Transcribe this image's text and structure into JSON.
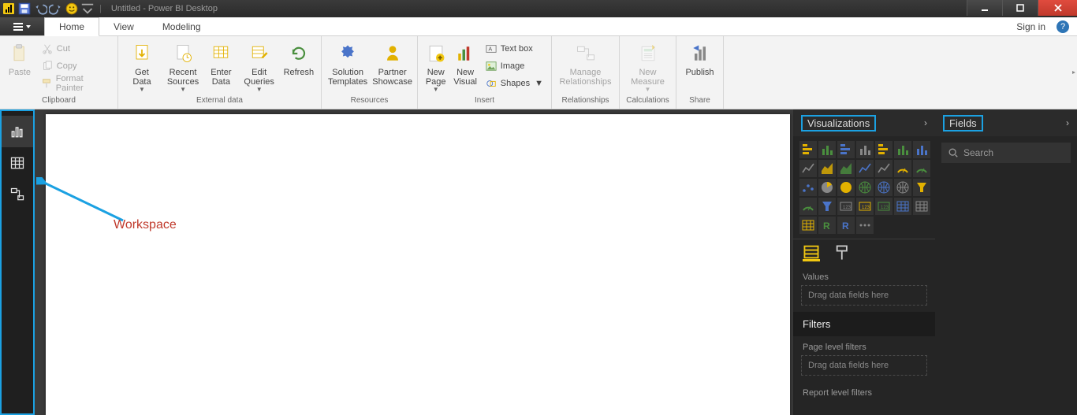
{
  "window": {
    "title": "Untitled - Power BI Desktop"
  },
  "qat": {
    "save": "save-icon",
    "undo": "undo-icon",
    "redo": "redo-icon",
    "smiley": "smiley-icon"
  },
  "tabs": {
    "file": "File",
    "home": "Home",
    "view": "View",
    "modeling": "Modeling"
  },
  "signin": "Sign in",
  "ribbon": {
    "clipboard": {
      "paste": "Paste",
      "cut": "Cut",
      "copy": "Copy",
      "format_painter": "Format Painter",
      "group": "Clipboard"
    },
    "external": {
      "get_data": "Get\nData",
      "recent_sources": "Recent\nSources",
      "enter_data": "Enter\nData",
      "edit_queries": "Edit\nQueries",
      "refresh": "Refresh",
      "group": "External data"
    },
    "resources": {
      "solution": "Solution\nTemplates",
      "partner": "Partner\nShowcase",
      "group": "Resources"
    },
    "insert": {
      "new_page": "New\nPage",
      "new_visual": "New\nVisual",
      "text_box": "Text box",
      "image": "Image",
      "shapes": "Shapes",
      "group": "Insert"
    },
    "relationships": {
      "manage": "Manage\nRelationships",
      "group": "Relationships"
    },
    "calculations": {
      "new_measure": "New\nMeasure",
      "group": "Calculations"
    },
    "share": {
      "publish": "Publish",
      "group": "Share"
    }
  },
  "leftrail": {
    "report": "report-view",
    "data": "data-view",
    "model": "model-view"
  },
  "annotation": "Workspace",
  "viz_pane": {
    "title": "Visualizations",
    "items": [
      "stacked-bar",
      "stacked-column",
      "clustered-bar",
      "clustered-column",
      "100-stacked-bar",
      "100-stacked-column",
      "small-multiples",
      "line",
      "area",
      "stacked-area",
      "line-clustered",
      "line-stacked",
      "ribbon",
      "waterfall",
      "scatter",
      "pie",
      "donut",
      "treemap",
      "map",
      "filled-map",
      "funnel-alt",
      "gauge",
      "funnel",
      "card",
      "multi-row-card",
      "kpi",
      "slicer",
      "table",
      "matrix",
      "r-visual",
      "py-visual",
      "more"
    ],
    "tabs": {
      "fields": "fields-tab",
      "format": "format-tab"
    },
    "values_label": "Values",
    "drop_hint": "Drag data fields here",
    "filters_title": "Filters",
    "page_filters": "Page level filters",
    "drop_hint2": "Drag data fields here",
    "report_filters": "Report level filters"
  },
  "fields_pane": {
    "title": "Fields",
    "search_placeholder": "Search"
  }
}
